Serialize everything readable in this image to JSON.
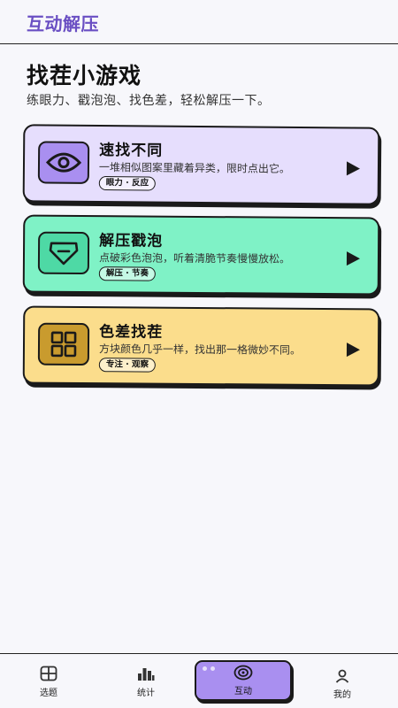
{
  "header": {
    "title": "互动解压"
  },
  "page": {
    "title": "找茬小游戏",
    "subtitle": "练眼力、戳泡泡、找色差，轻松解压一下。"
  },
  "games": [
    {
      "name": "速找不同",
      "description": "一堆相似图案里藏着异类，限时点出它。",
      "tag": "眼力 · 反应",
      "icon": "eye-icon",
      "color": "#e6defd"
    },
    {
      "name": "解压戳泡",
      "description": "点破彩色泡泡，听着清脆节奏慢慢放松。",
      "tag": "解压 · 节奏",
      "icon": "gem-icon",
      "color": "#7ff2c6"
    },
    {
      "name": "色差找茬",
      "description": "方块颜色几乎一样，找出那一格微妙不同。",
      "tag": "专注 · 观察",
      "icon": "grid-icon",
      "color": "#fbdd8c"
    }
  ],
  "tabbar": {
    "items": [
      {
        "label": "选题",
        "icon": "grid-icon"
      },
      {
        "label": "统计",
        "icon": "bar-chart-icon"
      },
      {
        "label": "互动",
        "icon": "target-icon",
        "active": true
      },
      {
        "label": "我的",
        "icon": "user-icon"
      }
    ]
  },
  "colors": {
    "accent": "#a98ff0",
    "title": "#6a4fc3"
  }
}
